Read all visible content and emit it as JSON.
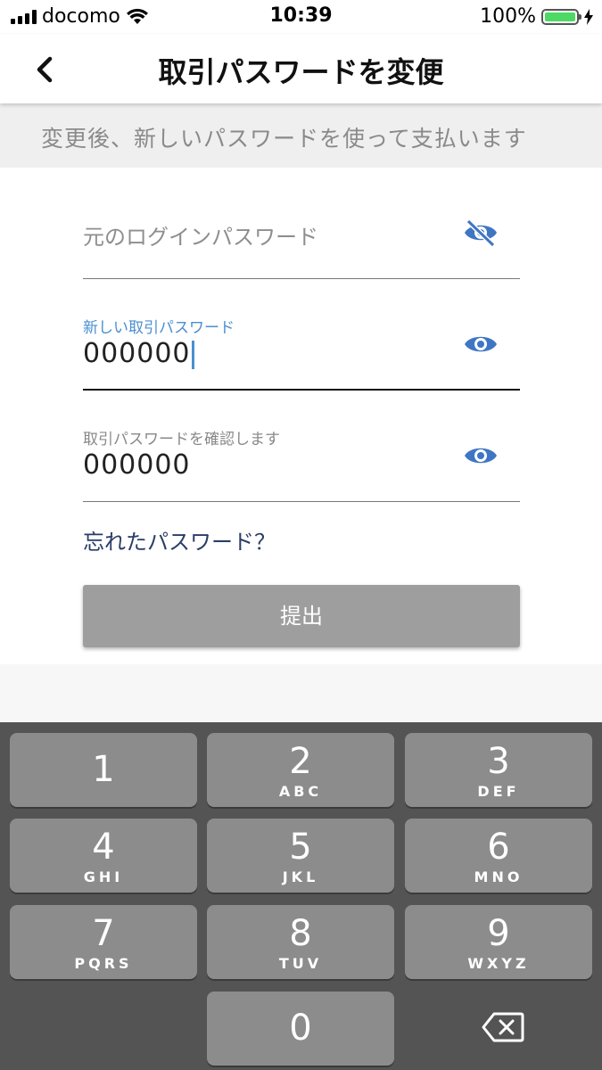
{
  "status": {
    "carrier": "docomo",
    "time": "10:39",
    "battery": "100%",
    "battery_color": "#4cd964"
  },
  "nav": {
    "title": "取引パスワードを変便",
    "back_icon": "chevron-left-icon"
  },
  "banner": {
    "text": "変更後、新しいパスワードを使って支払います"
  },
  "form": {
    "old_password": {
      "placeholder": "元のログインパスワード",
      "icon": "eye-off-icon"
    },
    "new_password": {
      "label": "新しい取引パスワード",
      "value": "000000",
      "icon": "eye-icon"
    },
    "confirm_password": {
      "label": "取引パスワードを確認します",
      "value": "000000",
      "icon": "eye-icon"
    },
    "forgot_link": "忘れたパスワード？",
    "submit_label": "提出"
  },
  "colors": {
    "accent": "#4a8fd0",
    "icon": "#3f76c3",
    "link": "#2a3d66",
    "button": "#9e9e9e",
    "keypad_bg": "#545454",
    "key_bg": "#8c8c8c"
  },
  "keypad": {
    "keys": [
      {
        "num": "1",
        "letters": ""
      },
      {
        "num": "2",
        "letters": "ABC"
      },
      {
        "num": "3",
        "letters": "DEF"
      },
      {
        "num": "4",
        "letters": "GHI"
      },
      {
        "num": "5",
        "letters": "JKL"
      },
      {
        "num": "6",
        "letters": "MNO"
      },
      {
        "num": "7",
        "letters": "PQRS"
      },
      {
        "num": "8",
        "letters": "TUV"
      },
      {
        "num": "9",
        "letters": "WXYZ"
      },
      {
        "num": "0",
        "letters": ""
      }
    ],
    "delete_icon": "backspace-icon"
  }
}
